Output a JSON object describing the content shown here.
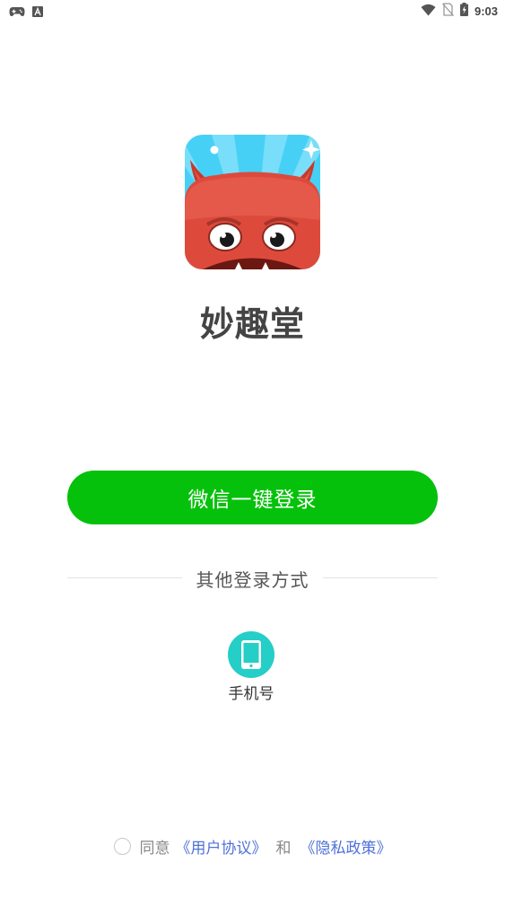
{
  "status_bar": {
    "time": "9:03",
    "icons": [
      "gamepad-icon",
      "font-a-icon",
      "wifi-icon",
      "no-sim-icon",
      "battery-charging-icon"
    ]
  },
  "app": {
    "name": "妙趣堂",
    "icon": "devil-mascot-icon"
  },
  "login": {
    "wechat_button": "微信一键登录",
    "other_methods_title": "其他登录方式",
    "phone_label": "手机号",
    "phone_icon": "phone-icon"
  },
  "agreement": {
    "prefix": "同意",
    "user_agreement": "《用户协议》",
    "and": "和",
    "privacy_policy": "《隐私政策》",
    "checked": false
  },
  "colors": {
    "wechat_green": "#06c10b",
    "phone_teal": "#25cec6",
    "link_blue": "#4f72d8",
    "title_gray": "#444444"
  }
}
